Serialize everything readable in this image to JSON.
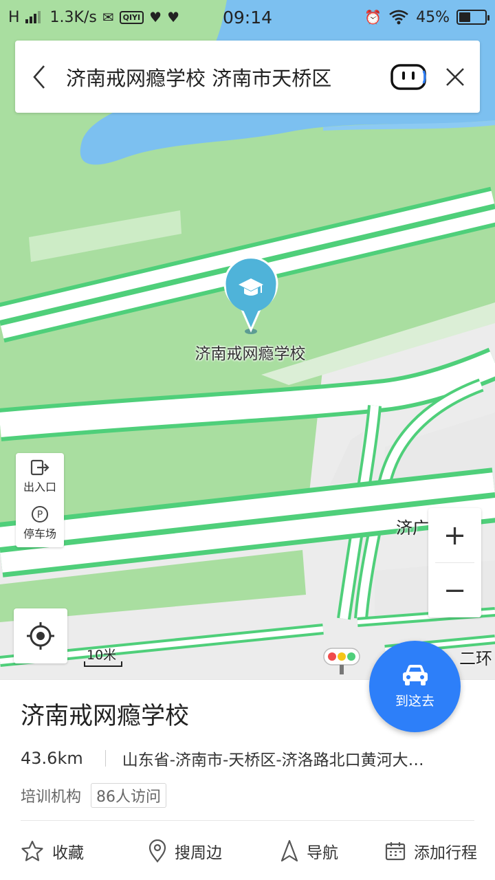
{
  "status_bar": {
    "network_type": "H",
    "speed": "1.3K/s",
    "app_badge": "QIYI",
    "time": "09:14",
    "battery": "45%",
    "battery_level": 0.45
  },
  "search": {
    "query": "济南戒网瘾学校 济南市天桥区"
  },
  "map": {
    "poi_label": "济南戒网瘾学校",
    "road_label_1": "济广",
    "road_label_2": "二环",
    "scale": "10米",
    "colors": {
      "park": "#a9dea0",
      "water": "#7cc0f0",
      "road_outline": "#4fcf7a",
      "road_fill": "#ffffff",
      "poi_pin": "#4fb3d9"
    }
  },
  "controls": {
    "entrance_label": "出入口",
    "parking_label": "停车场",
    "zoom_in": "+",
    "zoom_out": "−",
    "go_here": "到这去"
  },
  "place": {
    "name": "济南戒网瘾学校",
    "distance": "43.6km",
    "address": "山东省-济南市-天桥区-济洛路北口黄河大…",
    "category": "培训机构",
    "visits": "86人访问"
  },
  "actions": {
    "favorite": "收藏",
    "nearby": "搜周边",
    "navigate": "导航",
    "add_trip": "添加行程"
  },
  "accent_color": "#2d7ff9"
}
